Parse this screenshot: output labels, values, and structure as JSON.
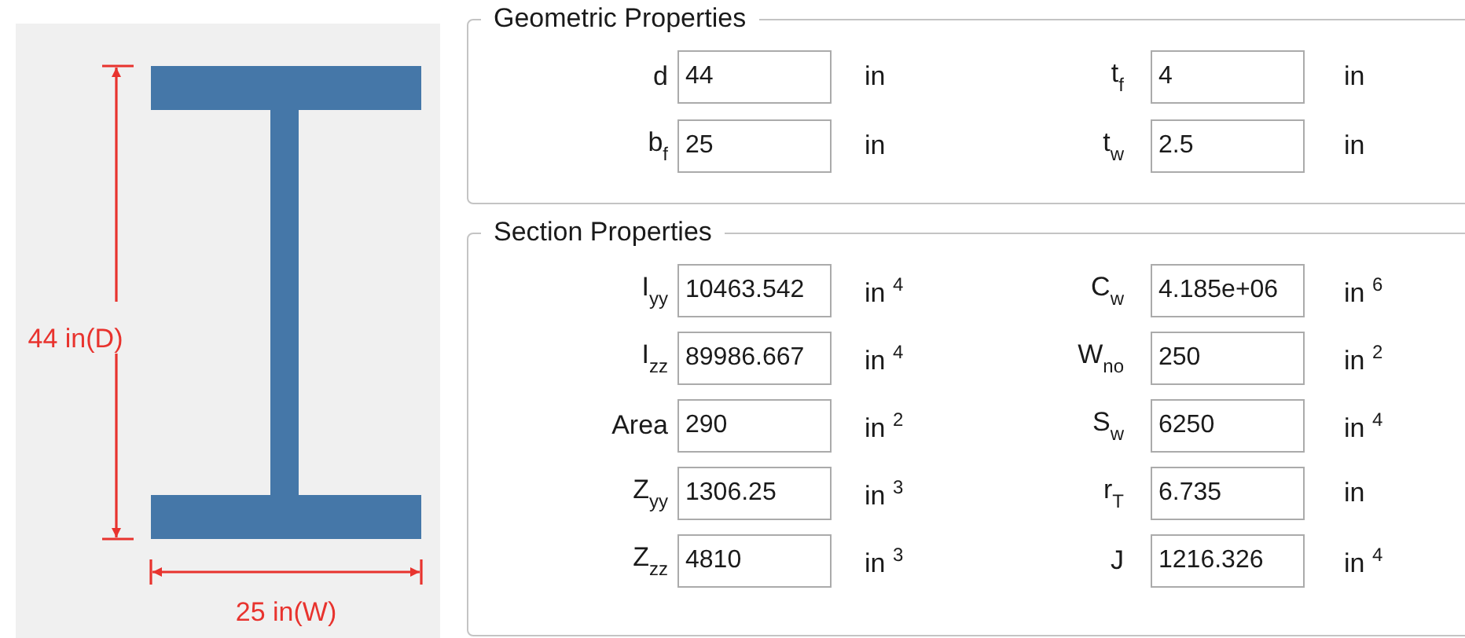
{
  "figure": {
    "depth_label": "44 in(D)",
    "width_label": "25 in(W)"
  },
  "groups": [
    {
      "title": "Geometric Properties",
      "items": [
        {
          "label": "d",
          "value": "44",
          "unit": "in"
        },
        {
          "label": "t$_{f}$",
          "value": "4",
          "unit": "in"
        },
        {
          "label": "b$_{f}$",
          "value": "25",
          "unit": "in"
        },
        {
          "label": "t$_{w}$",
          "value": "2.5",
          "unit": "in"
        }
      ]
    },
    {
      "title": "Section Properties",
      "items": [
        {
          "label": "I$_{yy}$",
          "value": "10463.542",
          "unit": "in $^{4}$"
        },
        {
          "label": "C$_{w}$",
          "value": "4.185e+06",
          "unit": "in $^{6}$"
        },
        {
          "label": "I$_{zz}$",
          "value": "89986.667",
          "unit": "in $^{4}$"
        },
        {
          "label": "W$_{no}$",
          "value": "250",
          "unit": "in $^{2}$"
        },
        {
          "label": "Area",
          "value": "290",
          "unit": "in $^{2}$"
        },
        {
          "label": "S$_{w}$",
          "value": "6250",
          "unit": "in $^{4}$"
        },
        {
          "label": "Z$_{yy}$",
          "value": "1306.25",
          "unit": "in $^{3}$"
        },
        {
          "label": "r$_{T}$",
          "value": "6.735",
          "unit": "in"
        },
        {
          "label": "Z$_{zz}$",
          "value": "4810",
          "unit": "in $^{3}$"
        },
        {
          "label": "J",
          "value": "1216.326",
          "unit": "in $^{4}$"
        }
      ]
    }
  ]
}
